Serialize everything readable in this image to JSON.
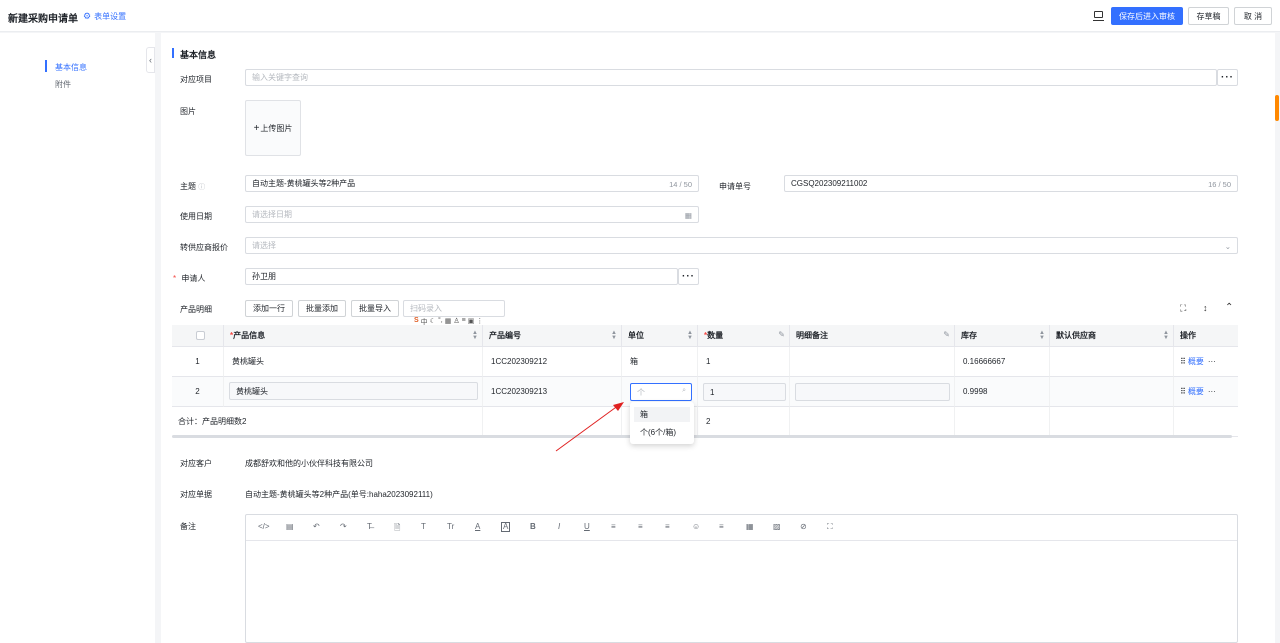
{
  "header": {
    "title": "新建采购申请单",
    "form_settings": "表单设置",
    "save_review": "保存后进入审核",
    "save_draft": "存草稿",
    "cancel": "取 消"
  },
  "leftnav": {
    "items": [
      "基本信息",
      "附件"
    ]
  },
  "section_title": "基本信息",
  "form": {
    "project_label": "对应项目",
    "project_placeholder": "输入关键字查询",
    "image_label": "图片",
    "upload_label": "上传图片",
    "subject_label": "主题",
    "subject_value": "自动主题-黄桃罐头等2种产品",
    "subject_count": "14 / 50",
    "apply_no_label": "申请单号",
    "apply_no_value": "CGSQ202309211002",
    "apply_no_count": "16 / 50",
    "use_date_label": "使用日期",
    "use_date_placeholder": "请选择日期",
    "quote_label": "转供应商报价",
    "quote_placeholder": "请选择",
    "applicant_label": "申请人",
    "applicant_value": "孙卫朋",
    "product_detail_label": "产品明细",
    "add_row": "添加一行",
    "batch_add": "批量添加",
    "batch_import": "批量导入",
    "scan_placeholder": "扫码录入"
  },
  "table": {
    "headers": [
      "产品信息",
      "产品编号",
      "单位",
      "数量",
      "明细备注",
      "库存",
      "默认供应商",
      "操作"
    ],
    "rows": [
      {
        "idx": "1",
        "product": "黄桃罐头",
        "code": "1CC202309212",
        "unit": "箱",
        "qty": "1",
        "note": "",
        "stock": "0.16666667",
        "op": "概要"
      },
      {
        "idx": "2",
        "product": "黄桃罐头",
        "code": "1CC202309213",
        "unit_placeholder": "个",
        "qty": "1",
        "note": "",
        "stock": "0.9998",
        "op": "概要"
      }
    ],
    "total_label": "合计：产品明细数2",
    "total_qty": "2"
  },
  "dropdown": {
    "options": [
      "箱",
      "个(6个/箱)"
    ]
  },
  "customer_label": "对应客户",
  "customer_value": "成都舒欢和他的小伙伴科技有限公司",
  "document_label": "对应单据",
  "document_value": "自动主题-黄桃罐头等2种产品(单号:haha2023092111)",
  "remark_label": "备注",
  "editor_tools": [
    "</>",
    "▤",
    "↶",
    "↷",
    "T̶",
    "🗎",
    "T",
    "Tr",
    "A",
    "A",
    "B",
    "I",
    "U",
    "≡",
    "≡",
    "≡",
    "☺",
    "≡",
    "▦",
    "▨",
    "⊘",
    "⛶"
  ],
  "colors": {
    "accent": "#3370ff",
    "required": "#f54a45",
    "arrow": "#e02020"
  }
}
